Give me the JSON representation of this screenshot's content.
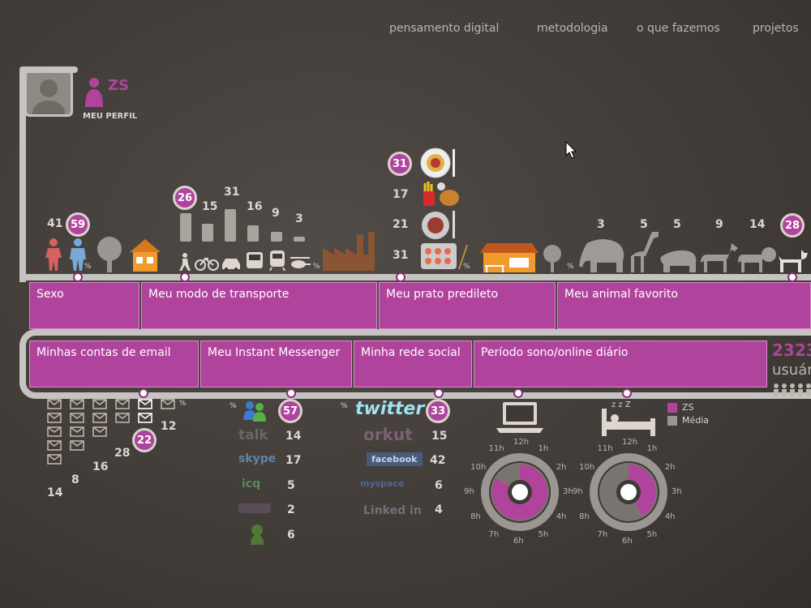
{
  "nav": [
    "pensamento digital",
    "metodologia",
    "o que fazemos",
    "projetos"
  ],
  "profile": {
    "initials": "ZS",
    "label": "MEU PERFIL"
  },
  "colors": {
    "accent": "#b0449c",
    "track": "#c6c4c1",
    "background": "#3e3935"
  },
  "top_bars": [
    "Sexo",
    "Meu modo de transporte",
    "Meu prato predileto",
    "Meu animal favorito"
  ],
  "bottom_bars": [
    "Minhas contas de email",
    "Meu Instant Messenger",
    "Minha rede social",
    "Período sono/online diário"
  ],
  "users": {
    "count": "2323",
    "label": "usuár"
  },
  "sexo": {
    "female": "41",
    "male_selected": "59",
    "pct": "%"
  },
  "transport": {
    "selected": "26",
    "values": [
      "15",
      "31",
      "16",
      "9",
      "3"
    ],
    "pct": "%",
    "fills": [
      0.95,
      0.55,
      1.0,
      0.5,
      0.3,
      0.15
    ]
  },
  "food": {
    "values": [
      "31",
      "17",
      "21",
      "31"
    ],
    "selected_index": 0,
    "pct": "%"
  },
  "animals": {
    "values": [
      "3",
      "5",
      "5",
      "9",
      "14",
      "28"
    ],
    "pct": "%"
  },
  "email": {
    "values": [
      "14",
      "8",
      "16",
      "28",
      "22",
      "12"
    ],
    "selected": "22",
    "pct": "%",
    "columns": [
      5,
      4,
      3,
      2,
      2,
      1
    ]
  },
  "messenger": {
    "pct": "%",
    "items": [
      {
        "icon": "msn-icon",
        "label": "",
        "value": "57",
        "selected": true
      },
      {
        "icon": "gtalk-icon",
        "label": "talk",
        "value": "14"
      },
      {
        "icon": "skype-icon",
        "label": "skype",
        "value": "17"
      },
      {
        "icon": "icq-icon",
        "label": "icq",
        "value": "5"
      },
      {
        "icon": "yahoo-icon",
        "label": "",
        "value": "2"
      },
      {
        "icon": "aim-icon",
        "label": "",
        "value": "6"
      }
    ]
  },
  "social": {
    "pct": "%",
    "items": [
      {
        "label": "twitter",
        "value": "33",
        "selected": true
      },
      {
        "label": "orkut",
        "value": "15"
      },
      {
        "label": "facebook",
        "value": "42"
      },
      {
        "label": "myspace",
        "value": "6"
      },
      {
        "label": "Linked in",
        "value": "4"
      }
    ]
  },
  "sleep": {
    "hours_left": [
      "12h",
      "1h",
      "2h",
      "3h",
      "4h",
      "5h",
      "6h",
      "7h",
      "8h",
      "9h",
      "10h",
      "11h"
    ],
    "hours_right": [
      "12h",
      "1h",
      "2h",
      "3h",
      "4h",
      "5h",
      "6h",
      "7h",
      "8h",
      "9h",
      "10h",
      "11h"
    ],
    "legend": [
      "ZS",
      "Média"
    ],
    "online_zs_hours": 10,
    "sleep_zs_hours": 5
  }
}
